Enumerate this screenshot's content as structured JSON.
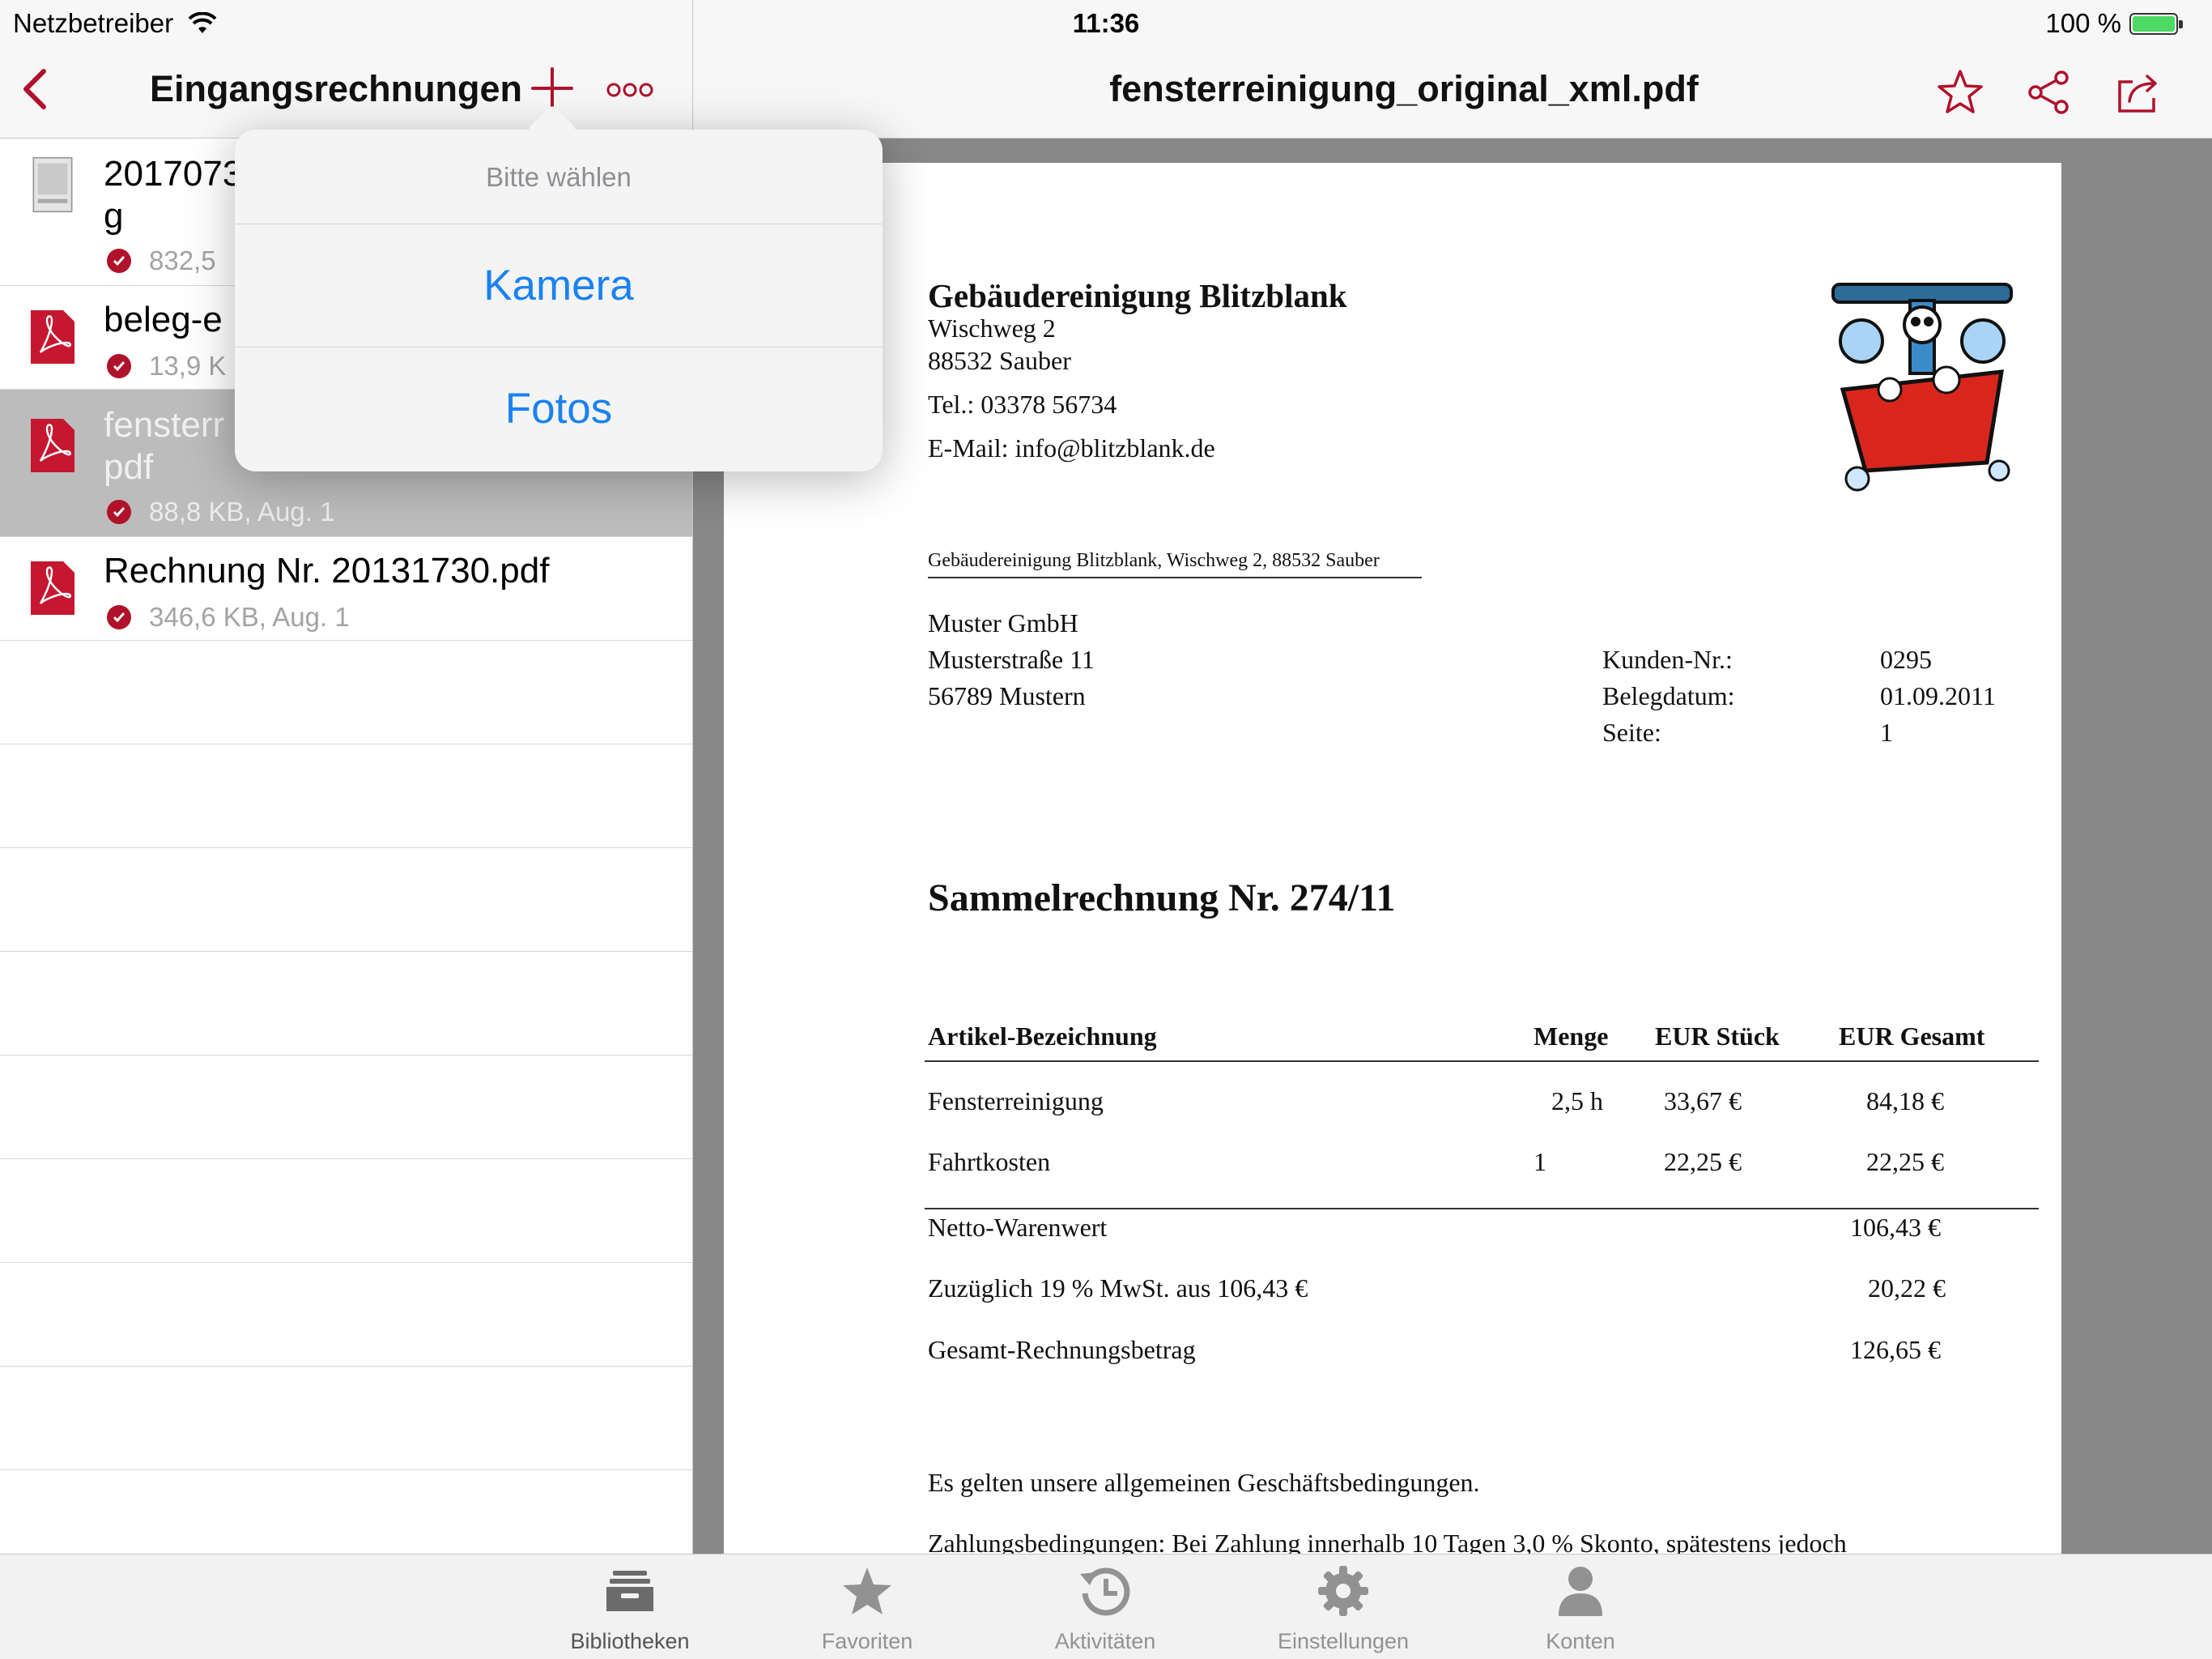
{
  "status_bar": {
    "carrier": "Netzbetreiber",
    "time": "11:36",
    "battery": "100 %",
    "battery_level": 1.0
  },
  "left_nav": {
    "title": "Eingangsrechnungen"
  },
  "right_nav": {
    "title": "fensterreinigung_original_xml.pdf"
  },
  "files": [
    {
      "name_line1": "2017073",
      "name_line2": "g",
      "meta": "832,5",
      "icon": "image-thumbnail-icon"
    },
    {
      "name_line1": "beleg-e",
      "name_line2": "",
      "meta": "13,9 K",
      "icon": "pdf-icon"
    },
    {
      "name_line1": "fensterr",
      "name_line2": "pdf",
      "meta": "88,8 KB, Aug. 1",
      "icon": "pdf-icon",
      "selected": true
    },
    {
      "name_line1": "Rechnung Nr. 20131730.pdf",
      "name_line2": "",
      "meta": "346,6 KB, Aug. 1",
      "icon": "pdf-icon"
    }
  ],
  "popover": {
    "header": "Bitte wählen",
    "actions": [
      "Kamera",
      "Fotos"
    ]
  },
  "document": {
    "company": "Gebäudereinigung Blitzblank",
    "street": "Wischweg 2",
    "city": "88532 Sauber",
    "phone": "Tel.: 03378 56734",
    "email": "E-Mail: info@blitzblank.de",
    "sender_line": "Gebäudereinigung Blitzblank, Wischweg 2, 88532 Sauber",
    "recipient": [
      "Muster GmbH",
      "Musterstraße 11",
      "56789 Mustern"
    ],
    "info": [
      {
        "label": "Kunden-Nr.:",
        "value": "0295"
      },
      {
        "label": "Belegdatum:",
        "value": "01.09.2011"
      },
      {
        "label": "Seite:",
        "value": "1"
      }
    ],
    "invoice_title": "Sammelrechnung Nr. 274/11",
    "table_headers": [
      "Artikel-Bezeichnung",
      "Menge",
      "EUR Stück",
      "EUR Gesamt"
    ],
    "rows": [
      {
        "item": "Fensterreinigung",
        "qty": "2,5 h",
        "unit": "33,67 €",
        "total": "84,18 €"
      },
      {
        "item": "Fahrtkosten",
        "qty": "1",
        "unit": "22,25 €",
        "total": "22,25 €"
      }
    ],
    "summary": [
      {
        "label": "Netto-Warenwert",
        "value": "106,43 €"
      },
      {
        "label": "Zuzüglich 19 % MwSt. aus 106,43 €",
        "value": "20,22 €"
      },
      {
        "label": "Gesamt-Rechnungsbetrag",
        "value": "126,65 €"
      }
    ],
    "terms": "Es gelten unsere allgemeinen Geschäftsbedingungen.",
    "payment": "Zahlungsbedingungen: Bei Zahlung innerhalb 10 Tagen 3,0 % Skonto, spätestens jedoch"
  },
  "tabs": [
    {
      "label": "Bibliotheken",
      "icon": "library-icon",
      "active": true
    },
    {
      "label": "Favoriten",
      "icon": "star-icon"
    },
    {
      "label": "Aktivitäten",
      "icon": "history-icon"
    },
    {
      "label": "Einstellungen",
      "icon": "gear-icon"
    },
    {
      "label": "Konten",
      "icon": "person-icon"
    }
  ],
  "colors": {
    "accent": "#b0122b",
    "link": "#1a82f0",
    "selected_row": "#bcbcbc"
  }
}
